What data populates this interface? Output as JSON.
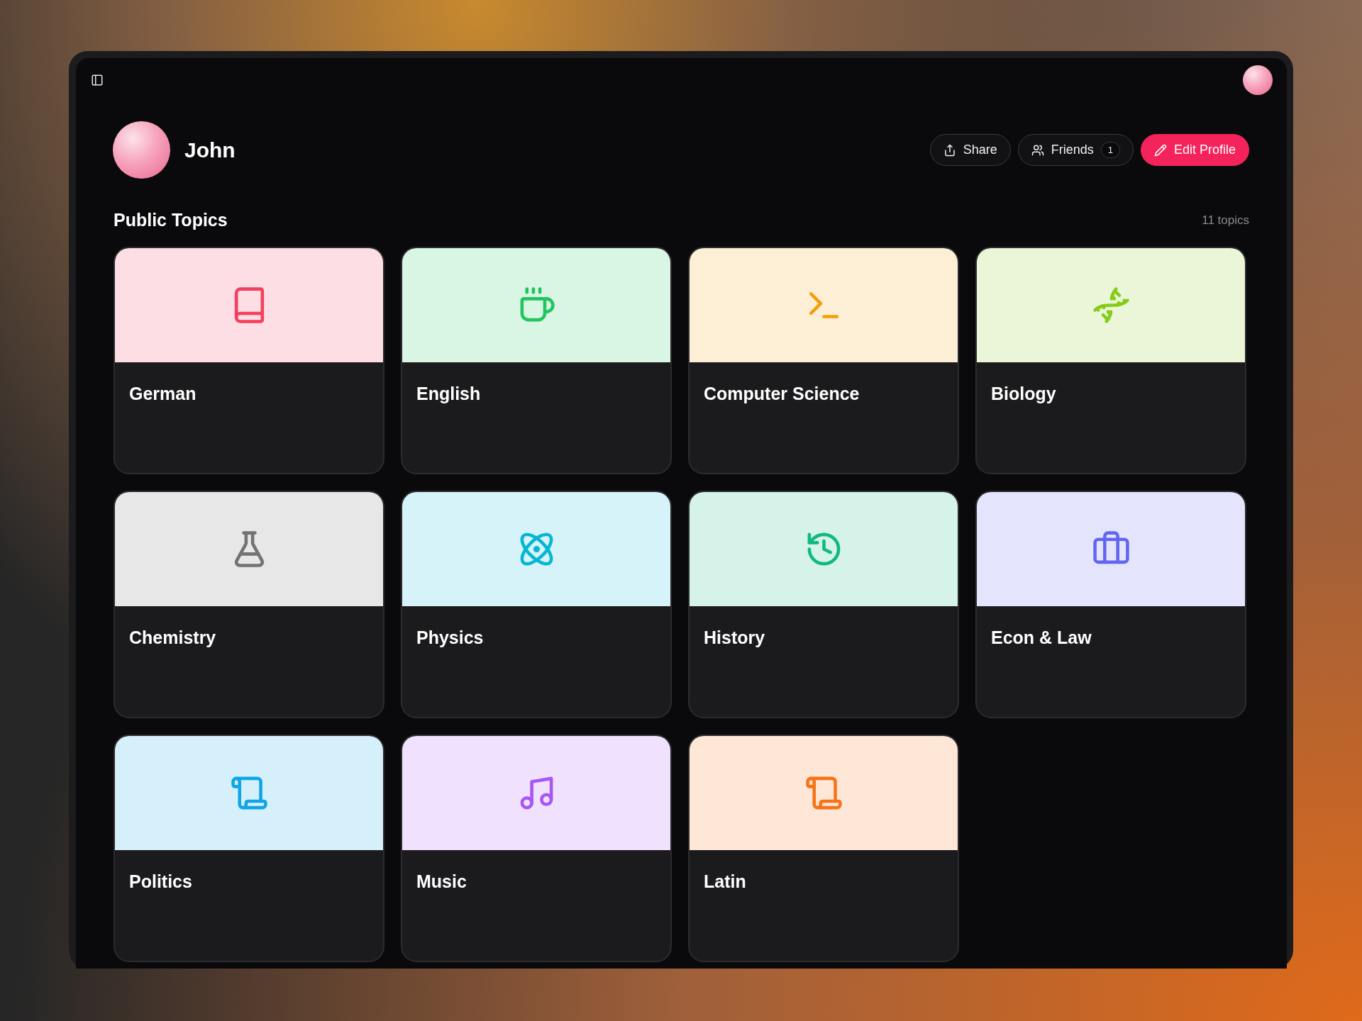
{
  "profile": {
    "name": "John"
  },
  "actions": {
    "share": "Share",
    "friends": "Friends",
    "friends_count": "1",
    "edit": "Edit Profile"
  },
  "section": {
    "title": "Public Topics",
    "count": "11 topics"
  },
  "topics": [
    {
      "name": "German",
      "color": "#f43f5e"
    },
    {
      "name": "English",
      "color": "#22c55e"
    },
    {
      "name": "Computer Science",
      "color": "#f59e0b"
    },
    {
      "name": "Biology",
      "color": "#84cc16"
    },
    {
      "name": "Chemistry",
      "color": "#737373"
    },
    {
      "name": "Physics",
      "color": "#06b6d4"
    },
    {
      "name": "History",
      "color": "#10b981"
    },
    {
      "name": "Econ & Law",
      "color": "#6366f1"
    },
    {
      "name": "Politics",
      "color": "#0ea5e9"
    },
    {
      "name": "Music",
      "color": "#a855f7"
    },
    {
      "name": "Latin",
      "color": "#f97316"
    }
  ]
}
